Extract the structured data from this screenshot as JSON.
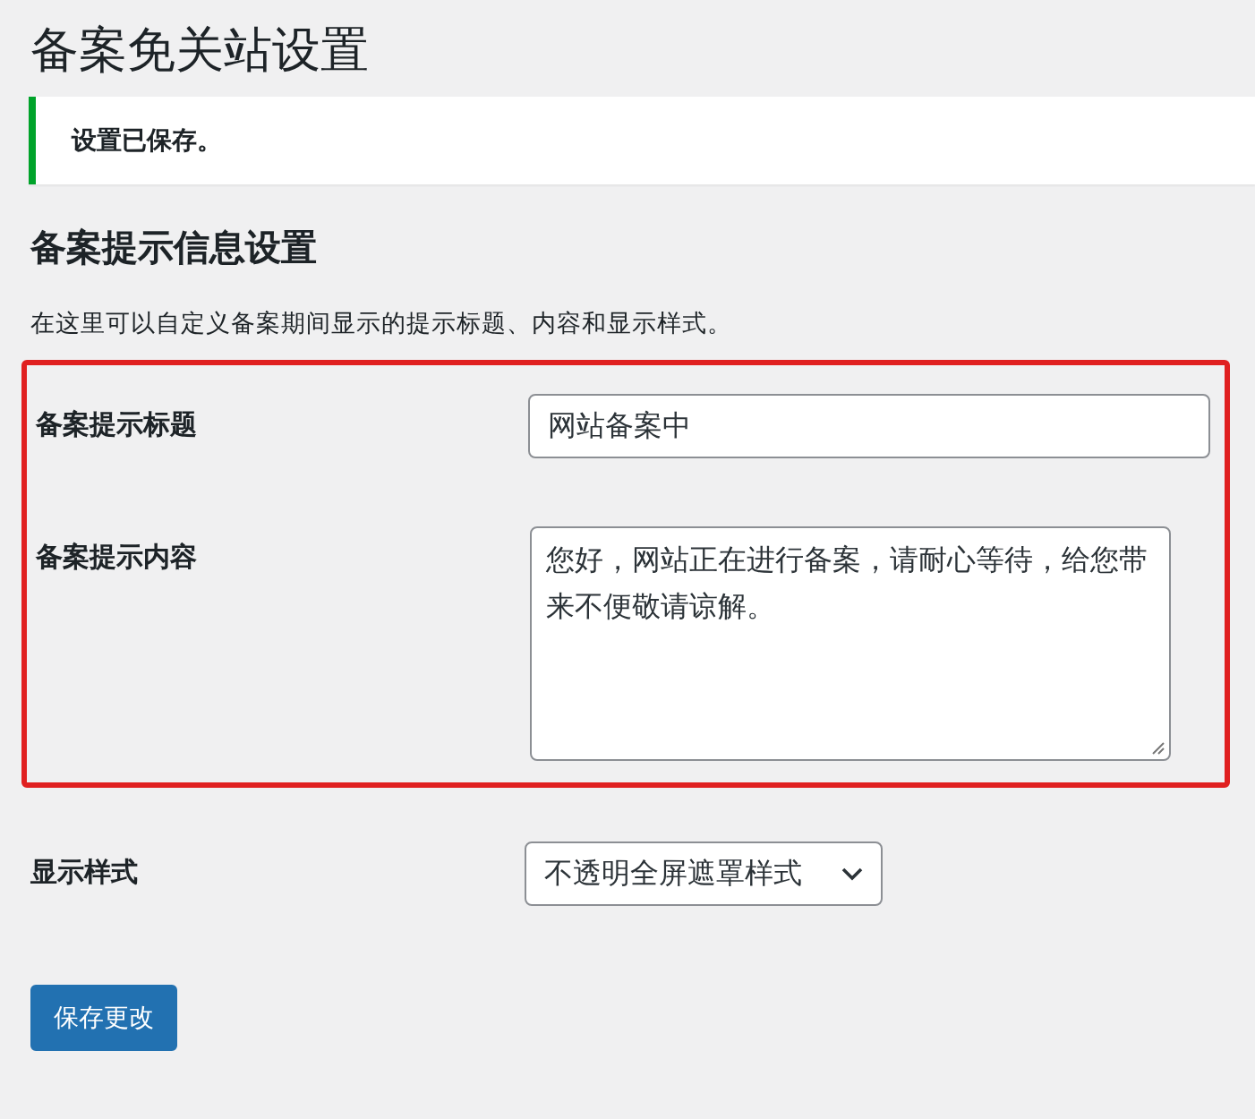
{
  "page_title": "备案免关站设置",
  "notice": {
    "text": "设置已保存。",
    "kind": "success"
  },
  "section": {
    "heading": "备案提示信息设置",
    "description": "在这里可以自定义备案期间显示的提示标题、内容和显示样式。"
  },
  "highlighted_fields": [
    {
      "label": "备案提示标题",
      "kind": "text",
      "value": "网站备案中"
    },
    {
      "label": "备案提示内容",
      "kind": "textarea",
      "value": "您好，网站正在进行备案，请耐心等待，给您带来不便敬请谅解。"
    }
  ],
  "fields": [
    {
      "label": "显示样式",
      "kind": "select",
      "value": "不透明全屏遮罩样式"
    }
  ],
  "submit_button": "保存更改"
}
